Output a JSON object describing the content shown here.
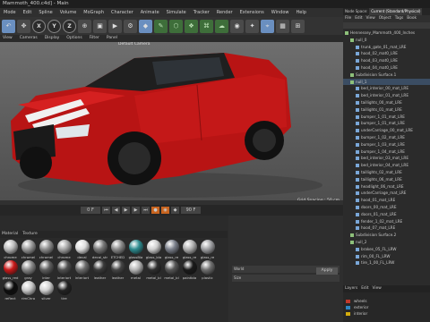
{
  "window_title": "Mammoth_400.c4d] - Main",
  "menu": [
    "Mode",
    "Edit",
    "Spline",
    "Volume",
    "MoGraph",
    "Character",
    "Animate",
    "Simulate",
    "Tracker",
    "Render",
    "Extensions",
    "Window",
    "Help"
  ],
  "viewport": {
    "tabs": [
      "View",
      "Cameras",
      "Display",
      "Options",
      "Filter",
      "Panel"
    ],
    "camera": "Default Camera",
    "grid_spacing": "Grid Spacing : 50 cm"
  },
  "timeline": {
    "frame": "0 F",
    "end": "90 F"
  },
  "material_tabs": [
    "Material",
    "Texture"
  ],
  "materials": [
    {
      "name": "chrome",
      "color": "#bbbbbb"
    },
    {
      "name": "chromel",
      "color": "#9a9a9a"
    },
    {
      "name": "chromel",
      "color": "#8d8d8d"
    },
    {
      "name": "chrome",
      "color": "#a6a6a6"
    },
    {
      "name": "decal",
      "color": "#dddddd"
    },
    {
      "name": "decal_str",
      "color": "#777777"
    },
    {
      "name": "ETCHED",
      "color": "#8a8a8a"
    },
    {
      "name": "glassBla",
      "color": "#2c8b8f"
    },
    {
      "name": "glass_bla",
      "color": "#cfcfcf"
    },
    {
      "name": "glass_re",
      "color": "#7a7f8a"
    },
    {
      "name": "glass_re",
      "color": "#b0b0b0"
    },
    {
      "name": "glass_re",
      "color": "#9fa0a3"
    },
    {
      "name": "glass_red",
      "color": "#c81818"
    },
    {
      "name": "gray",
      "color": "#888888"
    },
    {
      "name": "inter",
      "color": "#5e5e5e"
    },
    {
      "name": "interiort",
      "color": "#4f4f4f"
    },
    {
      "name": "interiort",
      "color": "#6a6a6a"
    },
    {
      "name": "leather",
      "color": "#3a3a3a"
    },
    {
      "name": "leather",
      "color": "#444444"
    },
    {
      "name": "metal",
      "color": "#b5b5b5"
    },
    {
      "name": "metal_bl",
      "color": "#2e2e2e"
    },
    {
      "name": "metal_bl",
      "color": "#565656"
    },
    {
      "name": "paintbla",
      "color": "#1a1a1a"
    },
    {
      "name": "plastic",
      "color": "#6f6f6f"
    },
    {
      "name": "reflect",
      "color": "#0d0d0d"
    },
    {
      "name": "rimChro",
      "color": "#c8c8c8"
    },
    {
      "name": "silver",
      "color": "#d0d0d0"
    },
    {
      "name": "tire",
      "color": "#222222"
    }
  ],
  "object_manager": {
    "tabs": [
      "Node Space:",
      "Current (Standard/Physical)",
      "File",
      "Edit",
      "View",
      "Object",
      "Tags",
      "Book"
    ],
    "rows": [
      "Hennessey_Mammoth_400_Inches",
      "null_0",
      "trunk_gate_01_mat_LRE",
      "hood_02_mat0_LRE",
      "hood_03_mat0_LRE",
      "hood_04_mat0_LRE",
      "Subdivision Surface.1",
      "null_1",
      "bed_interior_00_mat_LRE",
      "bed_interior_01_mat_LRE",
      "taillights_00_mat_LRE",
      "taillights_01_mat_LRE",
      "bumper_1_01_mat_LRE",
      "bumper_1_01_mat_LRE",
      "underCarriage_00_mat_LRE",
      "bumper_1_02_mat_LRE",
      "bumper_1_03_mat_LRE",
      "bumper_1_04_mat_LRE",
      "bed_interior_03_mat_LRE",
      "bed_interior_04_mat_LRE",
      "taillights_02_mat_LRE",
      "taillights_06_mat_LRE",
      "headlight_06_mat_LRE",
      "underCarriage_mat_LRE",
      "hood_01_mat_LRE",
      "doors_00_mat_LRE",
      "doors_01_mat_LRE",
      "fender_1_02_mat_LRE",
      "hood_07_mat_LRE",
      "Subdivision Surface.2",
      "null_2",
      "brakes_05_FL_LRW",
      "rim_00_FL_LRW",
      "tire_1_00_FL_LRW"
    ]
  },
  "layers": {
    "tabs": [
      "Layers",
      "Edit",
      "View"
    ],
    "items": [
      {
        "name": "wheels",
        "color": "#c0392b"
      },
      {
        "name": "exterior",
        "color": "#2e86c1"
      },
      {
        "name": "interior",
        "color": "#d4ac0d"
      }
    ]
  },
  "attributes": {
    "button": "Apply",
    "fields": [
      "World",
      "Size"
    ]
  }
}
